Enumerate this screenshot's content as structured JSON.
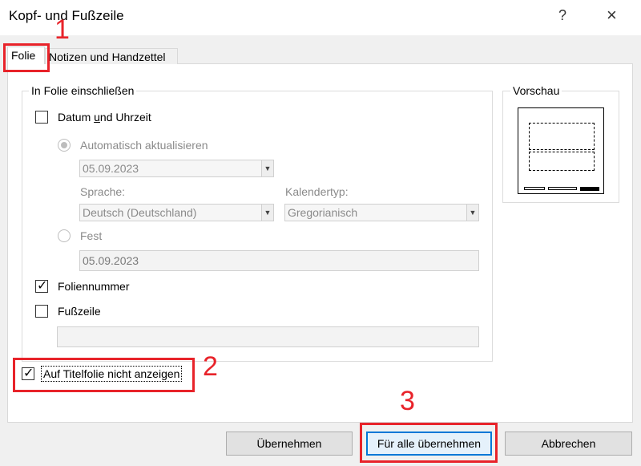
{
  "window": {
    "title": "Kopf- und Fußzeile",
    "help_glyph": "?",
    "close_glyph": "×"
  },
  "tabs": [
    {
      "label": "Folie",
      "active": true
    },
    {
      "label": "Notizen und Handzettel",
      "active": false
    }
  ],
  "include_group": {
    "label": "In Folie einschließen",
    "date_time": {
      "label": "Datum und Uhrzeit",
      "checked": false
    },
    "auto_update": {
      "label": "Automatisch aktualisieren",
      "selected": true,
      "date_value": "05.09.2023"
    },
    "language": {
      "label": "Sprache:",
      "value": "Deutsch (Deutschland)"
    },
    "calendar": {
      "label": "Kalendertyp:",
      "value": "Gregorianisch"
    },
    "fixed": {
      "label": "Fest",
      "selected": false,
      "value": "05.09.2023"
    },
    "slide_number": {
      "label": "Foliennummer",
      "checked": true
    },
    "footer": {
      "label": "Fußzeile",
      "checked": false,
      "value": ""
    }
  },
  "hide_on_title": {
    "label": "Auf Titelfolie nicht anzeigen",
    "checked": true
  },
  "preview": {
    "label": "Vorschau"
  },
  "buttons": {
    "apply": "Übernehmen",
    "apply_all": "Für alle übernehmen",
    "cancel": "Abbrechen"
  },
  "callouts": [
    "1",
    "2",
    "3"
  ],
  "colors": {
    "callout_red": "#e8232a",
    "focus_blue": "#0078d7"
  }
}
